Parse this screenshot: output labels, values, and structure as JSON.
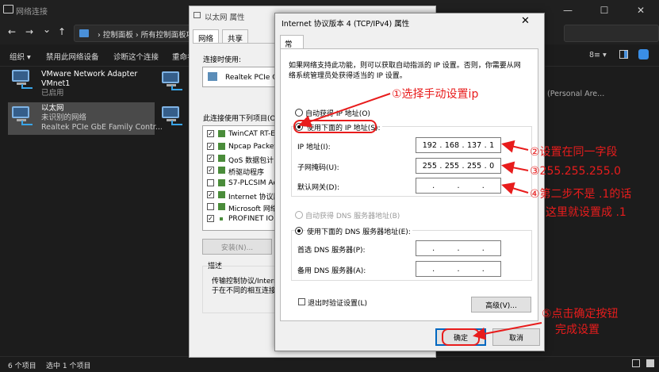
{
  "window": {
    "title": "网络连接"
  },
  "nav": {
    "back": "←",
    "forward": "→",
    "down": "⌄",
    "up": "↑",
    "path": "› 控制面板 › 所有控制面板项"
  },
  "toolbar": {
    "organize": "组织 ▾",
    "disable": "禁用此网络设备",
    "diagnose": "诊断这个连接",
    "rename": "重命名"
  },
  "adapters": [
    {
      "name": "VMware Network Adapter",
      "line2": "VMnet1",
      "status": "已启用"
    },
    {
      "name": "以太网",
      "line2": "未识别的网络",
      "status": "Realtek PCIe GbE Family Contr..."
    }
  ],
  "adapter_trailing": "(Personal Are...",
  "statusbar": {
    "count": "6 个项目",
    "selected": "选中 1 个项目"
  },
  "props_dialog": {
    "title": "以太网 属性",
    "tabs": [
      "网络",
      "共享"
    ],
    "connect_using": "连接时使用:",
    "device": "Realtek PCIe G",
    "items_label": "此连接使用下列项目(O):",
    "items": [
      {
        "label": "TwinCAT RT-E",
        "checked": true
      },
      {
        "label": "Npcap Packet",
        "checked": true
      },
      {
        "label": "QoS 数据包计",
        "checked": true
      },
      {
        "label": "桥驱动程序",
        "checked": true
      },
      {
        "label": "S7-PLCSIM Ac",
        "checked": false
      },
      {
        "label": "Internet 协议版",
        "checked": true
      },
      {
        "label": "Microsoft 网络",
        "checked": false
      },
      {
        "label": "PROFINET IO",
        "checked": true
      }
    ],
    "install_button": "安装(N)...",
    "desc_label": "描述",
    "desc_line1": "传输控制协议/Intern",
    "desc_line2": "于在不同的相互连接"
  },
  "tcp_dialog": {
    "title": "Internet 协议版本 4 (TCP/IPv4) 属性",
    "tab": "常规",
    "intro_line1": "如果网络支持此功能，则可以获取自动指派的 IP 设置。否则，你需要从网",
    "intro_line2": "络系统管理员处获得适当的 IP 设置。",
    "auto_ip": "自动获得 IP 地址(O)",
    "manual_ip": "使用下面的 IP 地址(S):",
    "ip_label": "IP 地址(I):",
    "mask_label": "子网掩码(U):",
    "gateway_label": "默认网关(D):",
    "ip_value": [
      "192",
      "168",
      "137",
      "1"
    ],
    "mask_value": [
      "255",
      "255",
      "255",
      "0"
    ],
    "gateway_value": [
      ".",
      ".",
      "."
    ],
    "auto_dns": "自动获得 DNS 服务器地址(B)",
    "manual_dns": "使用下面的 DNS 服务器地址(E):",
    "dns1_label": "首选 DNS 服务器(P):",
    "dns2_label": "备用 DNS 服务器(A):",
    "dns_value": [
      ".",
      ".",
      "."
    ],
    "validate": "退出时验证设置(L)",
    "advanced": "高级(V)...",
    "ok": "确定",
    "cancel": "取消"
  },
  "annotations": {
    "a1": "①选择手动设置ip",
    "a2": "②设置在同一字段",
    "a3": "③255.255.255.0",
    "a4_line1": "④第二步不是 .1的话",
    "a4_line2": "这里就设置成 .1",
    "a5_line1": "⑤点击确定按钮",
    "a5_line2": "完成设置"
  },
  "colors": {
    "annotation": "#e81c1c",
    "accent": "#0067c0",
    "window_bg": "#1c1c1c"
  }
}
